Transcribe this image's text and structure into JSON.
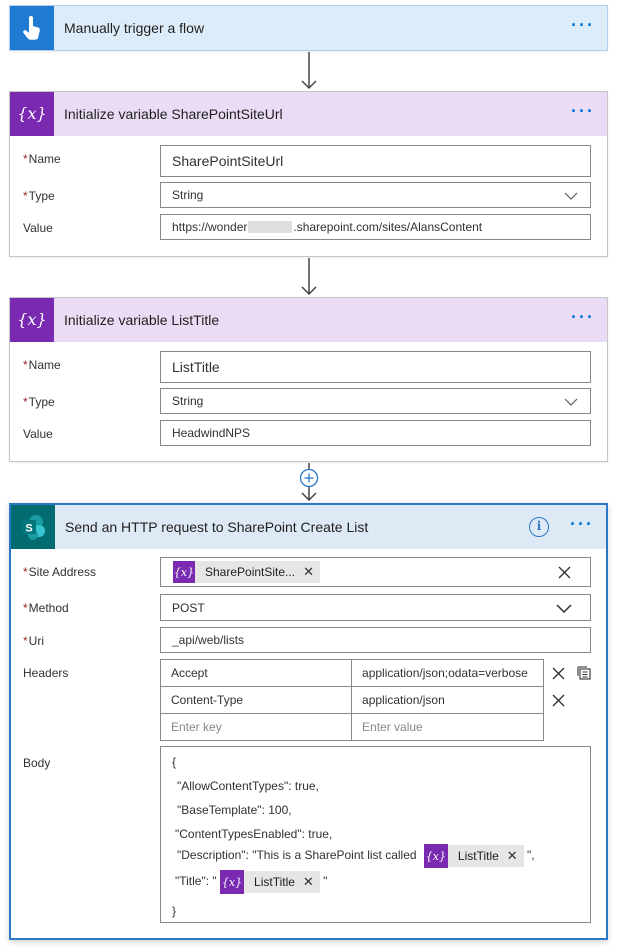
{
  "trigger": {
    "title": "Manually trigger a flow",
    "menu": "···"
  },
  "var1": {
    "title": "Initialize variable SharePointSiteUrl",
    "menu": "···",
    "name_label": "Name",
    "name_value": "SharePointSiteUrl",
    "type_label": "Type",
    "type_value": "String",
    "value_label": "Value",
    "value_prefix": "https://wonder",
    "value_suffix": ".sharepoint.com/sites/AlansContent"
  },
  "var2": {
    "title": "Initialize variable ListTitle",
    "menu": "···",
    "name_label": "Name",
    "name_value": "ListTitle",
    "type_label": "Type",
    "type_value": "String",
    "value_label": "Value",
    "value_value": "HeadwindNPS"
  },
  "http": {
    "title": "Send an HTTP request to SharePoint Create List",
    "menu": "···",
    "info": "i",
    "site_label": "Site Address",
    "site_token": "SharePointSite...",
    "method_label": "Method",
    "method_value": "POST",
    "uri_label": "Uri",
    "uri_value": "_api/web/lists",
    "headers_label": "Headers",
    "headers": [
      {
        "key": "Accept",
        "value": "application/json;odata=verbose"
      },
      {
        "key": "Content-Type",
        "value": "application/json"
      }
    ],
    "key_placeholder": "Enter key",
    "value_placeholder": "Enter value",
    "body_label": "Body",
    "body": {
      "open": "{",
      "line1": "\"AllowContentTypes\": true,",
      "line2": "\"BaseTemplate\": 100,",
      "line3": "\"ContentTypesEnabled\": true,",
      "line4_pre": "\"Description\": \"This is a SharePoint list called",
      "line4_token": "ListTitle",
      "line4_post": "\",",
      "line5_pre": "\"Title\": \"",
      "line5_token": "ListTitle",
      "line5_post": "\"",
      "close": "}"
    }
  },
  "icons": {
    "trigger": "hand-touch-icon",
    "variable": "variable-icon",
    "sharepoint": "sharepoint-icon",
    "token": "{x}"
  },
  "colors": {
    "trigger_header": "#ddecf9",
    "trigger_icon_bg": "#1f7bd1",
    "variable_header": "#eadcf4",
    "variable_icon_bg": "#7a2ab0",
    "http_header": "#dde9f5",
    "sharepoint_icon_bg": "#036c70",
    "accent": "#0078d4",
    "required": "#a4262c"
  }
}
